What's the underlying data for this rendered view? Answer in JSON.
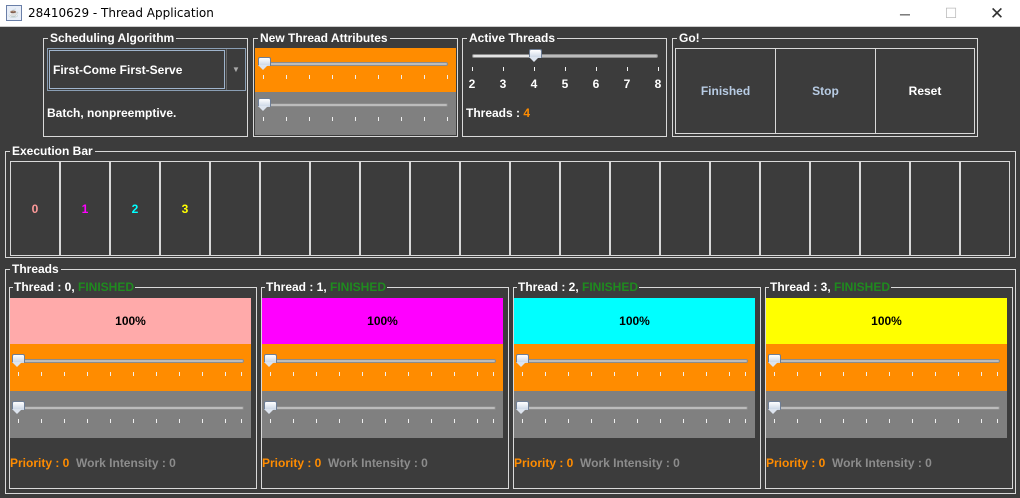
{
  "window": {
    "title": "28410629 - Thread Application",
    "icon": "java-cup-icon",
    "controls": {
      "minimize": "─",
      "maximize": "☐",
      "close": "✕"
    }
  },
  "scheduling": {
    "title": "Scheduling Algorithm",
    "selected": "First-Come First-Serve",
    "description": "Batch, nonpreemptive."
  },
  "new_thread": {
    "title": "New Thread Attributes",
    "priority_level": 0,
    "work_intensity_level": 0
  },
  "active_threads": {
    "title": "Active Threads",
    "tick_labels": [
      "2",
      "3",
      "4",
      "5",
      "6",
      "7",
      "8"
    ],
    "value": 4,
    "count_label": "Threads : ",
    "count_value": "4"
  },
  "go": {
    "title": "Go!",
    "buttons": [
      "Finished",
      "Stop",
      "Reset"
    ]
  },
  "execution_bar": {
    "title": "Execution Bar",
    "cells": [
      "0",
      "1",
      "2",
      "3",
      "",
      "",
      "",
      "",
      "",
      "",
      "",
      "",
      "",
      "",
      "",
      "",
      "",
      "",
      "",
      ""
    ],
    "cell_colors": [
      "#ff9a9a",
      "#ff00ff",
      "#00ffff",
      "#ffff00"
    ]
  },
  "threads": {
    "title": "Threads",
    "items": [
      {
        "label": "Thread : 0, ",
        "status": "FINISHED",
        "progress": "100%",
        "color": "#ffaaaa",
        "priority_label": "Priority : 0",
        "intensity_label": "Work Intensity : 0"
      },
      {
        "label": "Thread : 1, ",
        "status": "FINISHED",
        "progress": "100%",
        "color": "#ff00ff",
        "priority_label": "Priority : 0",
        "intensity_label": "Work Intensity : 0"
      },
      {
        "label": "Thread : 2, ",
        "status": "FINISHED",
        "progress": "100%",
        "color": "#00ffff",
        "priority_label": "Priority : 0",
        "intensity_label": "Work Intensity : 0"
      },
      {
        "label": "Thread : 3, ",
        "status": "FINISHED",
        "progress": "100%",
        "color": "#ffff00",
        "priority_label": "Priority : 0",
        "intensity_label": "Work Intensity : 0"
      }
    ]
  },
  "colors": {
    "background": "#3c3c3c",
    "accent_orange": "#ff8c00",
    "band_gray": "#808080",
    "status_green": "#1f8a1f"
  }
}
